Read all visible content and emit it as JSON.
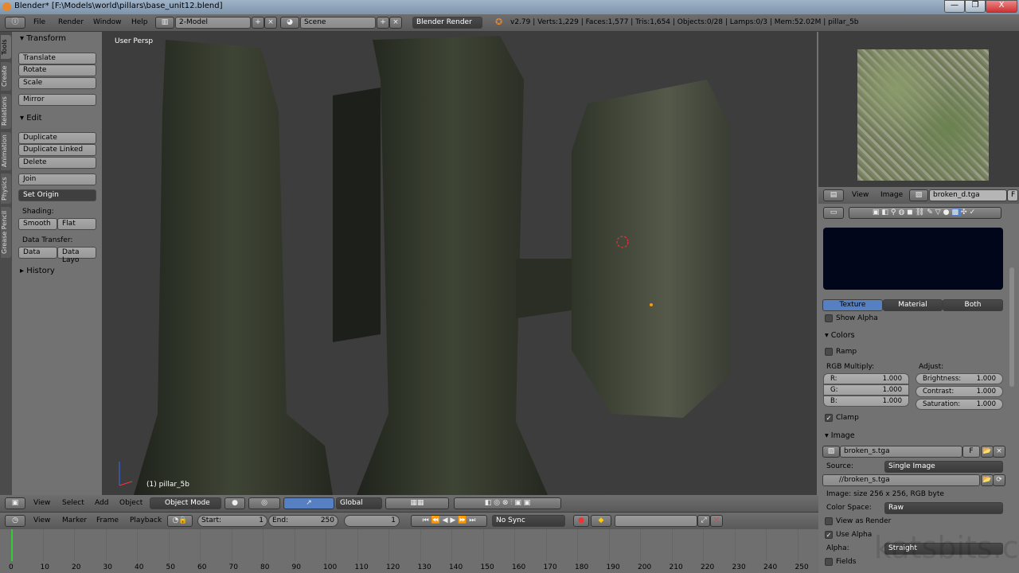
{
  "window": {
    "title": "Blender* [F:\\Models\\world\\pillars\\base_unit12.blend]",
    "minimize": "—",
    "maximize": "❐",
    "close": "X"
  },
  "info_header": {
    "menus": [
      "File",
      "Render",
      "Window",
      "Help"
    ],
    "layout": "2-Model",
    "scene": "Scene",
    "engine": "Blender Render",
    "stats": "v2.79 | Verts:1,229 | Faces:1,577 | Tris:1,654 | Objects:0/28 | Lamps:0/3 | Mem:52.02M | pillar_5b"
  },
  "tool_tabs": [
    "Tools",
    "Create",
    "Relations",
    "Animation",
    "Physics",
    "Grease Pencil"
  ],
  "tool_shelf": {
    "transform_title": "Transform",
    "transform": [
      "Translate",
      "Rotate",
      "Scale"
    ],
    "mirror": "Mirror",
    "edit_title": "Edit",
    "edit": [
      "Duplicate",
      "Duplicate Linked",
      "Delete"
    ],
    "join": "Join",
    "set_origin": "Set Origin",
    "shading_label": "Shading:",
    "smooth": "Smooth",
    "flat": "Flat",
    "data_transfer_label": "Data Transfer:",
    "data": "Data",
    "data_layo": "Data Layo",
    "history": "History"
  },
  "viewport": {
    "view_label": "User Persp",
    "object_label": "(1) pillar_5b"
  },
  "view3d_header": {
    "menus": [
      "View",
      "Select",
      "Add",
      "Object"
    ],
    "mode": "Object Mode",
    "orientation": "Global"
  },
  "timeline_header": {
    "menus": [
      "View",
      "Marker",
      "Frame",
      "Playback"
    ],
    "start_label": "Start:",
    "start": "1",
    "end_label": "End:",
    "end": "250",
    "current": "1",
    "sync": "No Sync"
  },
  "timeline": {
    "ticks": [
      "0",
      "10",
      "20",
      "30",
      "40",
      "50",
      "60",
      "70",
      "80",
      "90",
      "100",
      "110",
      "120",
      "130",
      "140",
      "150",
      "160",
      "170",
      "180",
      "190",
      "200",
      "210",
      "220",
      "230",
      "240",
      "250"
    ],
    "current_frame": 0,
    "playhead_color": "#33cc33"
  },
  "image_header": {
    "menus": [
      "View",
      "Image"
    ],
    "image": "broken_d.tga",
    "fake_user": "F"
  },
  "props": {
    "preview_tabs": [
      "Texture",
      "Material",
      "Both"
    ],
    "active_tab": "Texture",
    "show_alpha": "Show Alpha",
    "colors_title": "Colors",
    "ramp": "Ramp",
    "rgb_label": "RGB Multiply:",
    "adjust_label": "Adjust:",
    "rgb": [
      {
        "k": "R:",
        "v": "1.000"
      },
      {
        "k": "G:",
        "v": "1.000"
      },
      {
        "k": "B:",
        "v": "1.000"
      }
    ],
    "adjust": [
      {
        "k": "Brightness:",
        "v": "1.000"
      },
      {
        "k": "Contrast:",
        "v": "1.000"
      },
      {
        "k": "Saturation:",
        "v": "1.000"
      }
    ],
    "clamp": "Clamp",
    "image_title": "Image",
    "image_name": "broken_s.tga",
    "image_f": "F",
    "source_label": "Source:",
    "source": "Single Image",
    "path": "//broken_s.tga",
    "info": "Image: size 256 x 256, RGB byte",
    "colorspace_label": "Color Space:",
    "colorspace": "Raw",
    "view_as_render": "View as Render",
    "use_alpha": "Use Alpha",
    "alpha_label": "Alpha:",
    "alpha": "Straight",
    "fields": "Fields"
  },
  "watermark": "katsbits.com",
  "colors": {
    "accent": "#5680c2",
    "header": "#666666",
    "panel": "#727272",
    "viewport": "#3d3d3d"
  }
}
